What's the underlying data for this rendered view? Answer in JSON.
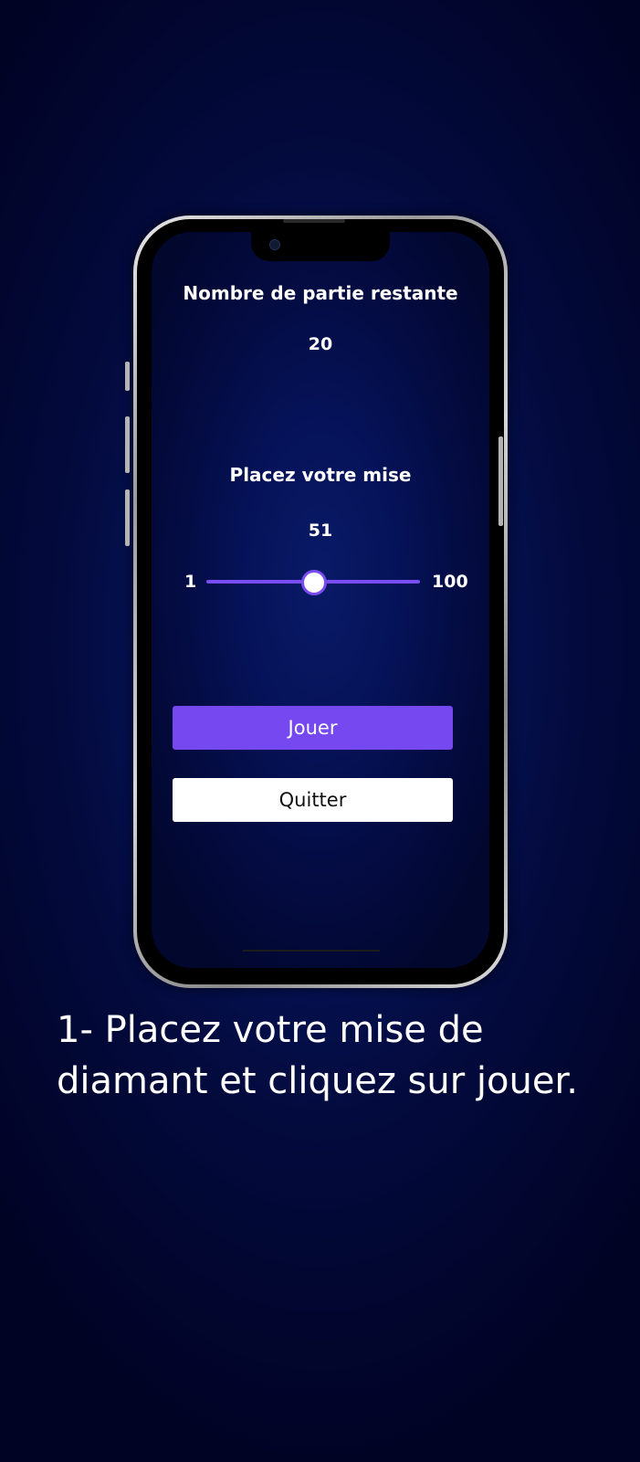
{
  "game": {
    "remaining_label": "Nombre de partie restante",
    "remaining_value": "20",
    "bet_label": "Placez votre mise",
    "bet_value": "51",
    "slider": {
      "min_label": "1",
      "max_label": "100",
      "min": 1,
      "max": 100,
      "value": 51
    },
    "play_button": "Jouer",
    "quit_button": "Quitter"
  },
  "caption": {
    "line1": "1- Placez votre mise de",
    "line2": "diamant et cliquez sur jouer."
  },
  "colors": {
    "accent": "#7548f0",
    "background": "#030a3c",
    "text": "#ffffff"
  }
}
